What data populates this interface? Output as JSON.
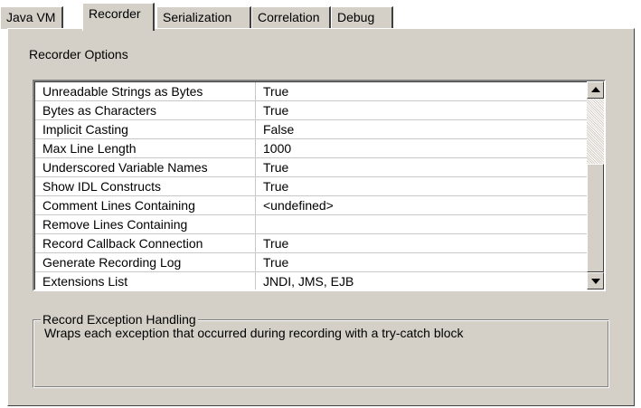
{
  "tabs": [
    {
      "label": "Java VM",
      "active": false
    },
    {
      "label": "Recorder",
      "active": true
    },
    {
      "label": "Serialization",
      "active": false
    },
    {
      "label": "Correlation",
      "active": false
    },
    {
      "label": "Debug",
      "active": false
    }
  ],
  "recorder_options": {
    "label": "Recorder Options",
    "rows": [
      {
        "name": "Unreadable Strings as Bytes",
        "value": "True"
      },
      {
        "name": "Bytes as Characters",
        "value": "True"
      },
      {
        "name": "Implicit Casting",
        "value": "False"
      },
      {
        "name": "Max Line Length",
        "value": "1000"
      },
      {
        "name": "Underscored Variable Names",
        "value": "True"
      },
      {
        "name": "Show IDL Constructs",
        "value": "True"
      },
      {
        "name": "Comment Lines Containing",
        "value": "<undefined>"
      },
      {
        "name": "Remove Lines Containing",
        "value": ""
      },
      {
        "name": "Record Callback Connection",
        "value": "True"
      },
      {
        "name": "Generate Recording Log",
        "value": "True"
      },
      {
        "name": "Extensions List",
        "value": "JNDI, JMS, EJB"
      }
    ]
  },
  "description": {
    "title": "Record Exception Handling",
    "text": "Wraps each exception that occurred during recording with a try-catch block"
  },
  "icons": {
    "scroll_up": "scroll-up-arrow-icon",
    "scroll_down": "scroll-down-arrow-icon"
  },
  "colors": {
    "panel": "#d4d0c8",
    "background": "#ffffff"
  }
}
